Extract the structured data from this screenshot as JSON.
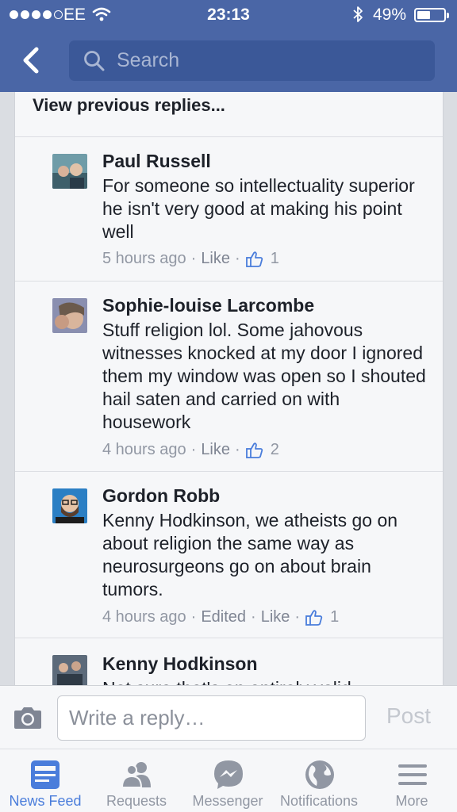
{
  "status_bar": {
    "carrier": "EE",
    "time": "23:13",
    "battery": "49%",
    "battery_level": 0.49
  },
  "search": {
    "placeholder": "Search"
  },
  "thread": {
    "view_previous": "View previous replies...",
    "comments": [
      {
        "author": "Paul Russell",
        "text": "For someone so intellectuality superior he isn't very good at making his point well",
        "time": "5 hours ago",
        "edited": "",
        "like": "Like",
        "likes": "1"
      },
      {
        "author": "Sophie-louise Larcombe",
        "text": "Stuff religion lol. Some jahovous witnesses knocked at my door I ignored them my window was open so I shouted hail saten and carried on with housework",
        "time": "4 hours ago",
        "edited": "",
        "like": "Like",
        "likes": "2"
      },
      {
        "author": "Gordon Robb",
        "text": "Kenny Hodkinson, we atheists go on about religion the same way as neurosurgeons go on about brain tumors.",
        "time": "4 hours ago",
        "edited": "Edited",
        "like": "Like",
        "likes": "1"
      },
      {
        "author": "Kenny Hodkinson",
        "text": "Not sure that's an entirely valid",
        "time": "",
        "edited": "",
        "like": "",
        "likes": ""
      }
    ]
  },
  "reply": {
    "placeholder": "Write a reply…",
    "post": "Post"
  },
  "tabs": [
    {
      "label": "News Feed",
      "icon": "news-feed-icon",
      "active": true
    },
    {
      "label": "Requests",
      "icon": "friend-requests-icon",
      "active": false
    },
    {
      "label": "Messenger",
      "icon": "messenger-icon",
      "active": false
    },
    {
      "label": "Notifications",
      "icon": "globe-icon",
      "active": false
    },
    {
      "label": "More",
      "icon": "menu-icon",
      "active": false
    }
  ],
  "colors": {
    "header": "#4a66a6",
    "search": "#3b5898",
    "accent": "#4a7ddb",
    "muted": "#9197a3"
  }
}
